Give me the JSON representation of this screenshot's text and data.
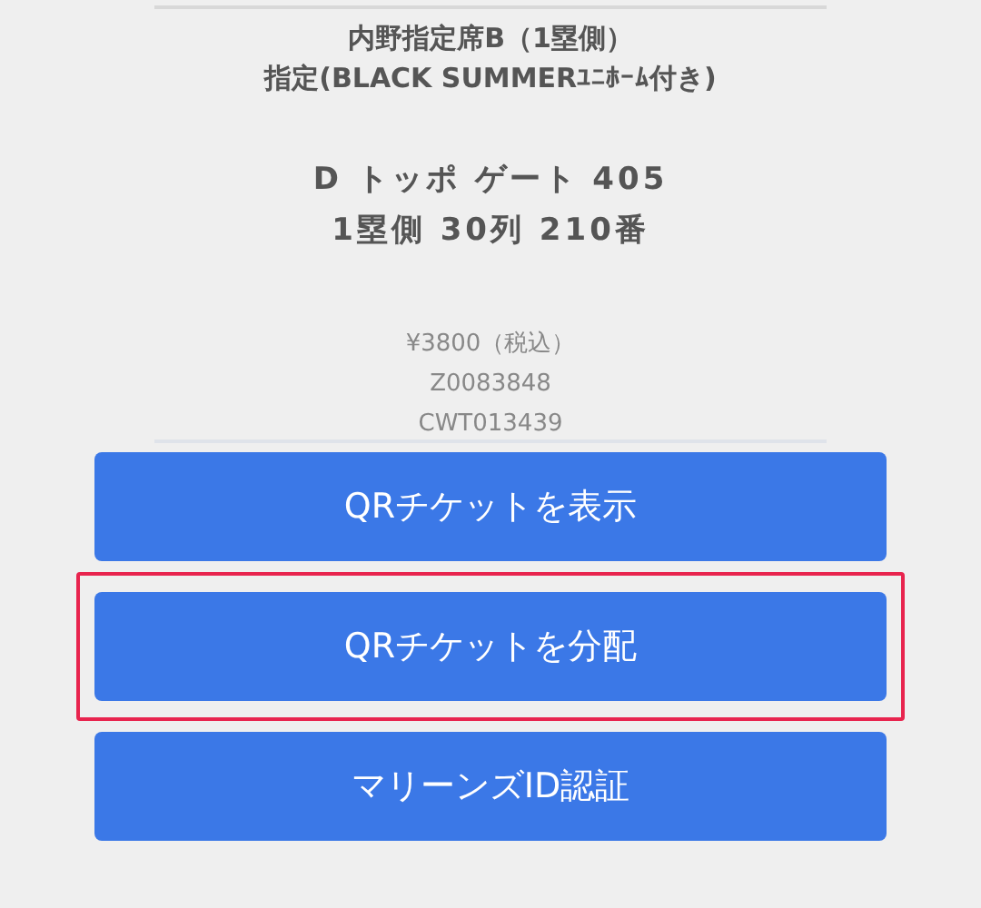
{
  "ticket": {
    "seat_lines": [
      "内野指定席B（1塁側）",
      "指定(BLACK SUMMERﾕﾆﾎｰﾑ付き)"
    ],
    "gate_lines": [
      "D トッポ ゲート 405",
      "1塁側 30列 210番"
    ],
    "info_lines": [
      "¥3800（税込）",
      "Z0083848",
      "CWT013439"
    ]
  },
  "buttons": [
    {
      "label": "QRチケットを表示",
      "highlighted": false
    },
    {
      "label": "QRチケットを分配",
      "highlighted": true
    },
    {
      "label": "マリーンズID認証",
      "highlighted": false
    }
  ]
}
